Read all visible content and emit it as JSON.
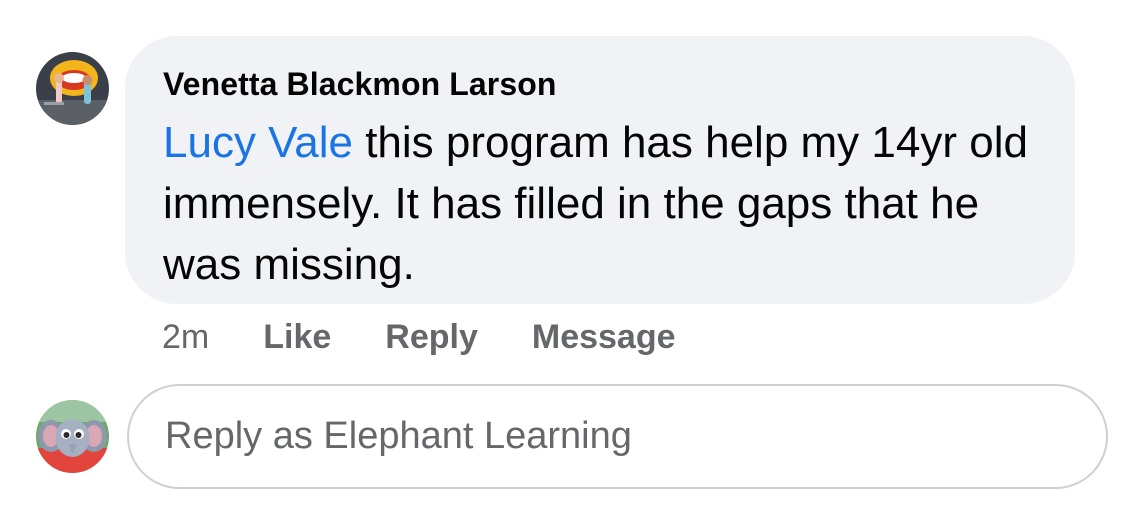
{
  "comment": {
    "author": "Venetta Blackmon Larson",
    "mention": "Lucy Vale",
    "text": " this program has help my 14yr old immensely. It has filled in the gaps that he was missing.",
    "time": "2m",
    "actions": {
      "like": "Like",
      "reply": "Reply",
      "message": "Message"
    },
    "avatar_icon": "user-photo-avatar"
  },
  "reply_box": {
    "placeholder": "Reply as Elephant Learning",
    "value": "",
    "avatar_icon": "elephant-mascot-avatar"
  },
  "colors": {
    "bubble": "#f0f2f5",
    "mention": "#1b74e4",
    "secondary_text": "#65676b",
    "input_border": "#ced0d4"
  }
}
